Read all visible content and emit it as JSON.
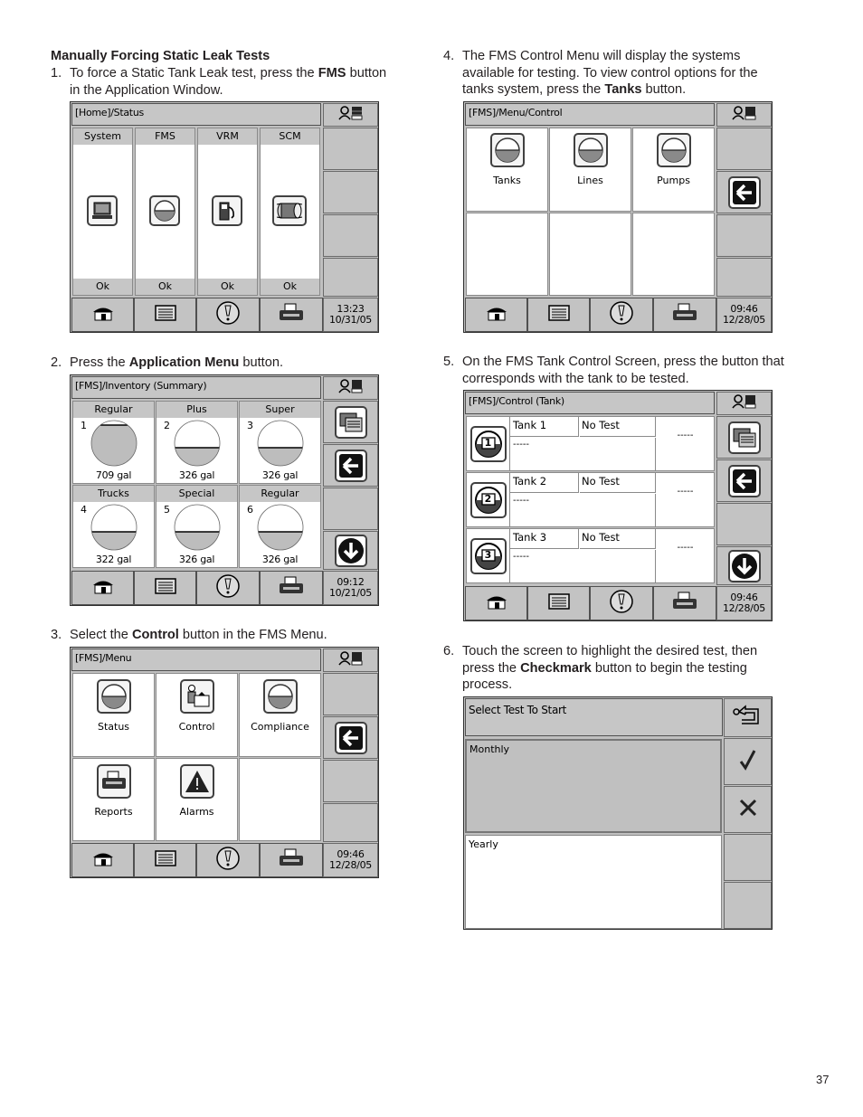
{
  "section_heading": "Manually Forcing Static Leak Tests",
  "steps": [
    {
      "num": "1.",
      "pre": "To force a Static Tank Leak test, press the ",
      "bold": "FMS",
      "post": " button",
      "line2": "in the Application Window."
    },
    {
      "num": "2.",
      "pre": "Press the ",
      "bold": "Application Menu",
      "post": " button."
    },
    {
      "num": "3.",
      "pre": "Select the ",
      "bold": "Control",
      "post": " button in the FMS Menu."
    },
    {
      "num": "4.",
      "line1": "The FMS Control Menu will display the systems",
      "line2": "available for testing. To view control options for the",
      "pre": "tanks system, press the ",
      "bold": "Tanks",
      "post": " button."
    },
    {
      "num": "5.",
      "line1": "On the FMS Tank Control Screen, press the button that",
      "line2": "corresponds with the tank to be tested."
    },
    {
      "num": "6.",
      "line1": "Touch the screen to highlight the desired test, then",
      "pre": "press the ",
      "bold": "Checkmark",
      "post": " button to begin the testing",
      "line3": "process."
    }
  ],
  "footer_bar": {
    "home_icon": "home-icon",
    "menu_icon": "list-icon",
    "alarm_icon": "exclamation-icon",
    "print_icon": "printer-icon"
  },
  "screen_status": {
    "title": "[Home]/Status",
    "columns": [
      {
        "label": "System",
        "icon": "computer-icon",
        "status": "Ok"
      },
      {
        "label": "FMS",
        "icon": "tank-icon",
        "status": "Ok"
      },
      {
        "label": "VRM",
        "icon": "fuel-pump-icon",
        "status": "Ok"
      },
      {
        "label": "SCM",
        "icon": "cylinder-icon",
        "status": "Ok"
      }
    ],
    "time": "13:23",
    "date": "10/31/05"
  },
  "screen_inventory": {
    "title": "[FMS]/Inventory (Summary)",
    "tanks": [
      {
        "name": "Regular",
        "num": "1",
        "volume": "709 gal",
        "fill": 0.9
      },
      {
        "name": "Plus",
        "num": "2",
        "volume": "326 gal",
        "fill": 0.4
      },
      {
        "name": "Super",
        "num": "3",
        "volume": "326 gal",
        "fill": 0.4
      },
      {
        "name": "Trucks",
        "num": "4",
        "volume": "322 gal",
        "fill": 0.4
      },
      {
        "name": "Special",
        "num": "5",
        "volume": "326 gal",
        "fill": 0.4
      },
      {
        "name": "Regular",
        "num": "6",
        "volume": "326 gal",
        "fill": 0.4
      }
    ],
    "time": "09:12",
    "date": "10/21/05"
  },
  "screen_fms_menu": {
    "title": "[FMS]/Menu",
    "items": [
      {
        "label": "Status",
        "icon": "tank-icon"
      },
      {
        "label": "Control",
        "icon": "operator-icon"
      },
      {
        "label": "Compliance",
        "icon": "tank-icon"
      },
      {
        "label": "Reports",
        "icon": "printer-icon"
      },
      {
        "label": "Alarms",
        "icon": "warning-icon"
      }
    ],
    "time": "09:46",
    "date": "12/28/05"
  },
  "screen_control": {
    "title": "[FMS]/Menu/Control",
    "items": [
      {
        "label": "Tanks"
      },
      {
        "label": "Lines"
      },
      {
        "label": "Pumps"
      }
    ],
    "time": "09:46",
    "date": "12/28/05"
  },
  "screen_tank_control": {
    "title": "[FMS]/Control (Tank)",
    "rows": [
      {
        "num": "1",
        "name": "Tank 1",
        "test": "No Test",
        "detail": "-----",
        "result": "-----"
      },
      {
        "num": "2",
        "name": "Tank 2",
        "test": "No Test",
        "detail": "-----",
        "result": "-----"
      },
      {
        "num": "3",
        "name": "Tank 3",
        "test": "No Test",
        "detail": "-----",
        "result": "-----"
      }
    ],
    "time": "09:46",
    "date": "12/28/05"
  },
  "screen_select_test": {
    "title": "Select Test To Start",
    "options": [
      {
        "label": "Monthly",
        "selected": true
      },
      {
        "label": "Yearly",
        "selected": false
      }
    ]
  },
  "page_number": "37"
}
